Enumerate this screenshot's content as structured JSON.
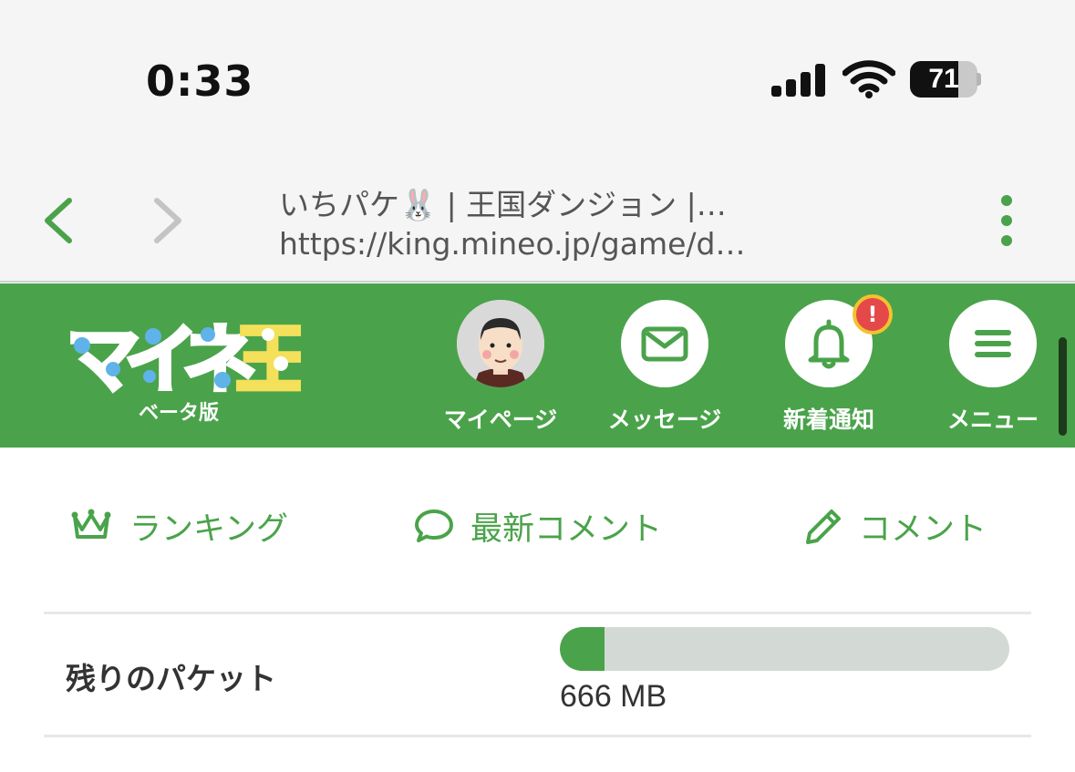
{
  "status_bar": {
    "time": "0:33",
    "battery_percent": 71,
    "battery_label": "71",
    "icons": [
      "cellular-signal-icon",
      "wifi-icon",
      "battery-icon"
    ]
  },
  "browser": {
    "page_title": "いちパケ🐰 | 王国ダンジョン |…",
    "url": "https://king.mineo.jp/game/d…",
    "icons": [
      "back-arrow-icon",
      "forward-arrow-icon",
      "more-vertical-icon"
    ]
  },
  "header": {
    "logo_text": "マイネ王",
    "logo_sub": "ベータ版",
    "items": [
      {
        "label": "マイページ",
        "icon": "avatar-icon"
      },
      {
        "label": "メッセージ",
        "icon": "envelope-icon"
      },
      {
        "label": "新着通知",
        "icon": "bell-icon",
        "badge": "!"
      },
      {
        "label": "メニュー",
        "icon": "hamburger-menu-icon"
      }
    ]
  },
  "subnav": {
    "items": [
      {
        "label": "ランキング",
        "icon": "crown-icon"
      },
      {
        "label": "最新コメント",
        "icon": "speech-bubble-icon"
      },
      {
        "label": "コメント",
        "icon": "pencil-icon"
      }
    ]
  },
  "packet": {
    "label": "残りのパケット",
    "value_text": "666 MB",
    "fill_fraction": 0.1
  },
  "colors": {
    "brand_green": "#4aa34a",
    "badge_red": "#e54848",
    "badge_ring": "#f2c230",
    "bar_track": "#d3dad5"
  }
}
